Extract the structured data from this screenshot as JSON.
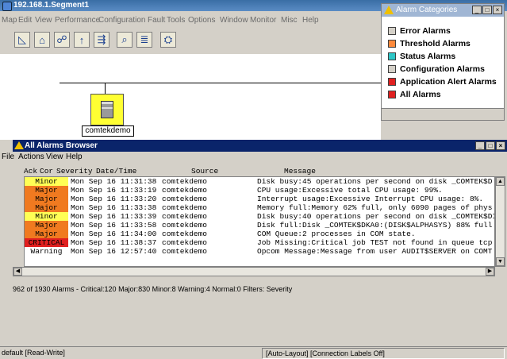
{
  "main": {
    "title": "192.168.1.Segment1",
    "menu": [
      "Map",
      "Edit",
      "View",
      "Performance",
      "Configuration",
      "Fault",
      "Tools",
      "Options",
      "Window",
      "Monitor",
      "Misc",
      "Help"
    ],
    "node_label": "comtekdemo"
  },
  "alarm_categories": {
    "title": "Alarm Categories",
    "items": [
      {
        "label": "Error Alarms",
        "color": "#d4d0c8"
      },
      {
        "label": "Threshold Alarms",
        "color": "#ff8a3c"
      },
      {
        "label": "Status Alarms",
        "color": "#2ec6c6"
      },
      {
        "label": "Configuration Alarms",
        "color": "#d4d0c8"
      },
      {
        "label": "Application Alert Alarms",
        "color": "#e02020"
      },
      {
        "label": "All Alarms",
        "color": "#e02020"
      }
    ]
  },
  "browser": {
    "title": "All Alarms Browser",
    "menu": [
      "File",
      "Actions",
      "View",
      "Help"
    ],
    "headers": {
      "ack": "Ack",
      "cor": "Cor",
      "severity": "Severity",
      "datetime": "Date/Time",
      "source": "Source",
      "message": "Message"
    },
    "rows": [
      {
        "severity": "Minor",
        "sev_color": "#ffff55",
        "datetime": "Mon Sep 16 11:31:38",
        "source": "comtekdemo",
        "message": "Disk busy:45 operations per second on disk _COMTEK$D"
      },
      {
        "severity": "Major",
        "sev_color": "#f07a20",
        "datetime": "Mon Sep 16 11:33:19",
        "source": "comtekdemo",
        "message": "CPU usage:Excessive total CPU usage: 99%."
      },
      {
        "severity": "Major",
        "sev_color": "#f07a20",
        "datetime": "Mon Sep 16 11:33:20",
        "source": "comtekdemo",
        "message": "Interrupt usage:Excessive Interrupt CPU usage: 8%."
      },
      {
        "severity": "Major",
        "sev_color": "#f07a20",
        "datetime": "Mon Sep 16 11:33:38",
        "source": "comtekdemo",
        "message": "Memory full:Memory 62% full, only 6090 pages of phys"
      },
      {
        "severity": "Minor",
        "sev_color": "#ffff55",
        "datetime": "Mon Sep 16 11:33:39",
        "source": "comtekdemo",
        "message": "Disk busy:40 operations per second on disk _COMTEK$DI"
      },
      {
        "severity": "Major",
        "sev_color": "#f07a20",
        "datetime": "Mon Sep 16 11:33:58",
        "source": "comtekdemo",
        "message": "Disk full:Disk _COMTEK$DKA0:(DISK$ALPHASYS) 88% full"
      },
      {
        "severity": "Major",
        "sev_color": "#f07a20",
        "datetime": "Mon Sep 16 11:34:00",
        "source": "comtekdemo",
        "message": "COM Queue:2 processes in COM state."
      },
      {
        "severity": "CRITICAL",
        "sev_color": "#e02020",
        "datetime": "Mon Sep 16 11:38:37",
        "source": "comtekdemo",
        "message": "Job Missing:Critical job TEST not found in queue tcp"
      },
      {
        "severity": "Warning",
        "sev_color": "#ffffff",
        "datetime": "Mon Sep 16 12:57:40",
        "source": "comtekdemo",
        "message": "Opcom Message:Message from user AUDIT$SERVER on COMT"
      }
    ],
    "status": "962 of 1930 Alarms - Critical:120  Major:830  Minor:8  Warning:4  Normal:0   Filters: Severity"
  },
  "statusbar": {
    "mode": "default [Read-Write]",
    "layout": "[Auto-Layout] [Connection Labels Off]"
  }
}
